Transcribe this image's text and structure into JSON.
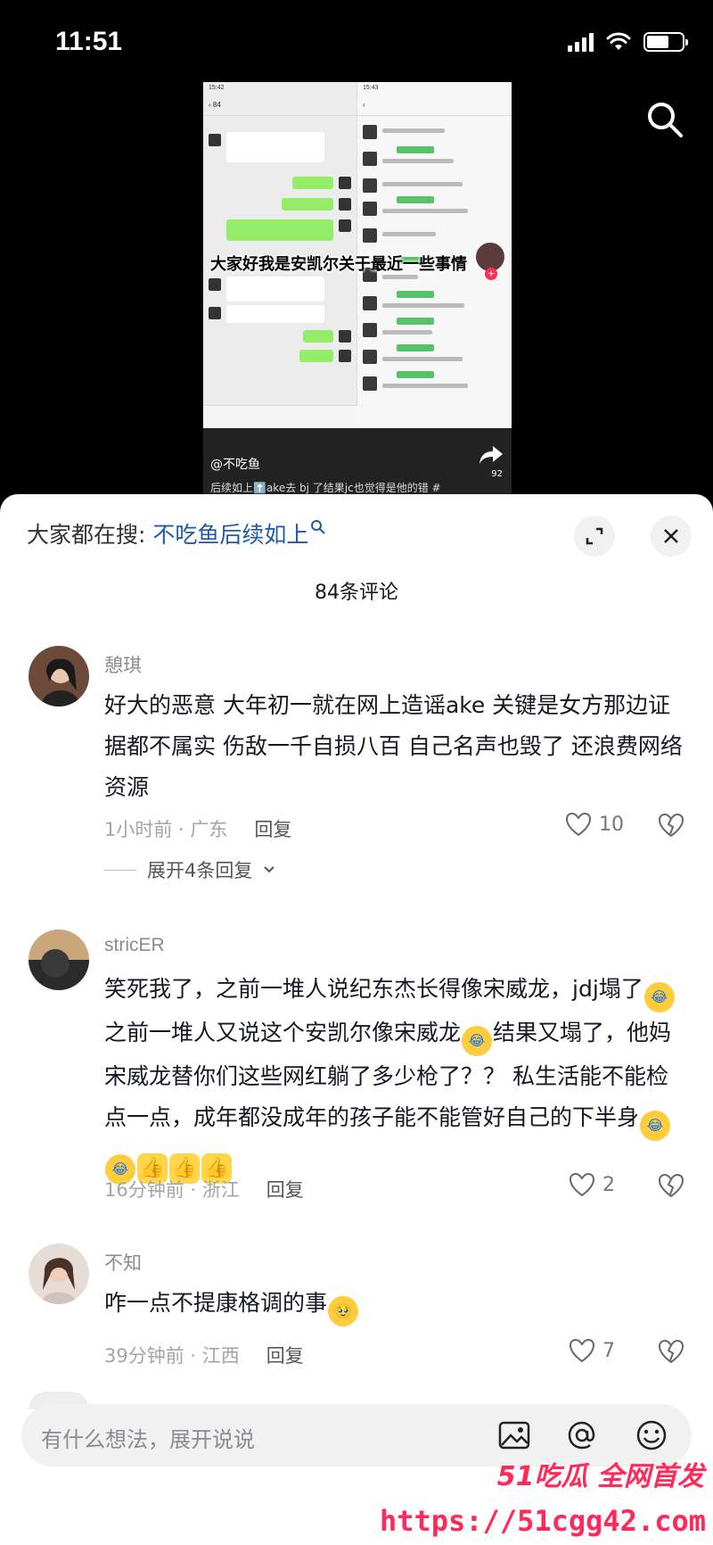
{
  "status": {
    "time": "11:51"
  },
  "video": {
    "caption": "大家好我是安凯尔关于最近一些事情",
    "author": "@不吃鱼",
    "description": "后续如上⬆️ake去 bj 了结果jc也觉得是他的错 #",
    "share_count": "92",
    "left_phone_time": "15:42",
    "right_phone_time": "15:43"
  },
  "sheet": {
    "search_prefix": "大家都在搜: ",
    "search_term": "不吃鱼后续如上",
    "comment_count": "84条评论"
  },
  "comments": [
    {
      "name": "憩琪",
      "text": "好大的恶意 大年初一就在网上造谣ake 关键是女方那边证据都不属实 伤敌一千自损八百 自己名声也毁了 还浪费网络资源",
      "meta": "1小时前 · 广东",
      "reply": "回复",
      "likes": "10",
      "expand": "展开4条回复"
    },
    {
      "name": "stricER",
      "text_parts": [
        "笑死我了，之前一堆人说纪东杰长得像宋威龙，jdj塌了",
        "之前一堆人又说这个安凯尔像宋威龙",
        "结果又塌了，他妈宋威龙替你们这些网红躺了多少枪了？？ 私生活能不能检点一点，成年都没成年的孩子能不能管好自己的下半身"
      ],
      "meta": "16分钟前 · 浙江",
      "reply": "回复",
      "likes": "2"
    },
    {
      "name": "不知",
      "text": "咋一点不提康格调的事",
      "meta": "39分钟前 · 江西",
      "reply": "回复",
      "likes": "7"
    }
  ],
  "input": {
    "placeholder": "有什么想法，展开说说"
  },
  "watermark": {
    "brand": "51吃瓜 全网首发",
    "url": "https://51cgg42.com"
  },
  "colors": {
    "link": "#1f5aa6",
    "accent": "#fe2c55",
    "wechat_green": "#95ec69"
  }
}
